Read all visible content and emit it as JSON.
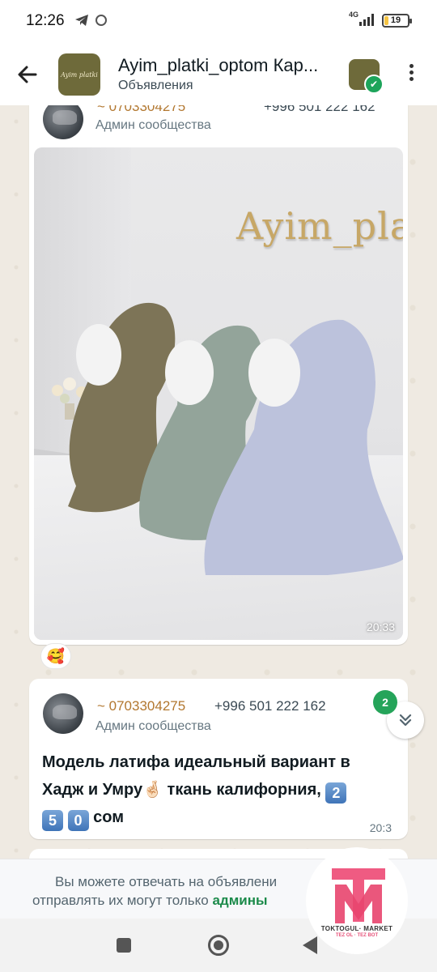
{
  "status_bar": {
    "time": "12:26",
    "network": "4G",
    "battery": "19",
    "battery_level_percent": 19
  },
  "header": {
    "title": "Ayim_platki_optom Кар...",
    "subtitle": "Объявления",
    "avatar_text": "Ayim platki"
  },
  "messages": [
    {
      "sender_phone": "~ 0703304275",
      "sender_phone2": "+996 501 222 162",
      "sender_role": "Админ сообщества",
      "photo_brand_text": "Ayim_plat",
      "time": "20:33",
      "reaction": "🥰"
    },
    {
      "sender_phone": "~ 0703304275",
      "sender_phone2": "+996 501 222 162",
      "sender_role": "Админ сообщества",
      "text_part1": "Модель латифа идеальный вариант в Хадж и Умру",
      "text_emoji_fingers": "🤞🏻",
      "text_part2": " ткань калифорния, ",
      "digit1": "2",
      "digit2": "5",
      "digit3": "0",
      "text_part3": " сом",
      "time": "20:3"
    }
  ],
  "unread_count": "2",
  "notice": {
    "line1": "Вы можете отвечать на объявлени",
    "line2_prefix": "отправлять их могут только ",
    "line2_admins": "админы"
  },
  "watermark": {
    "line1": "TOKTOGUL· MARKET",
    "line2": "TEZ OL · TEZ BOT"
  },
  "colors": {
    "accent_green": "#1b8a4a",
    "badge_green": "#25a45a",
    "phone_gold": "#b2772f",
    "chat_bg": "#efeae2"
  }
}
